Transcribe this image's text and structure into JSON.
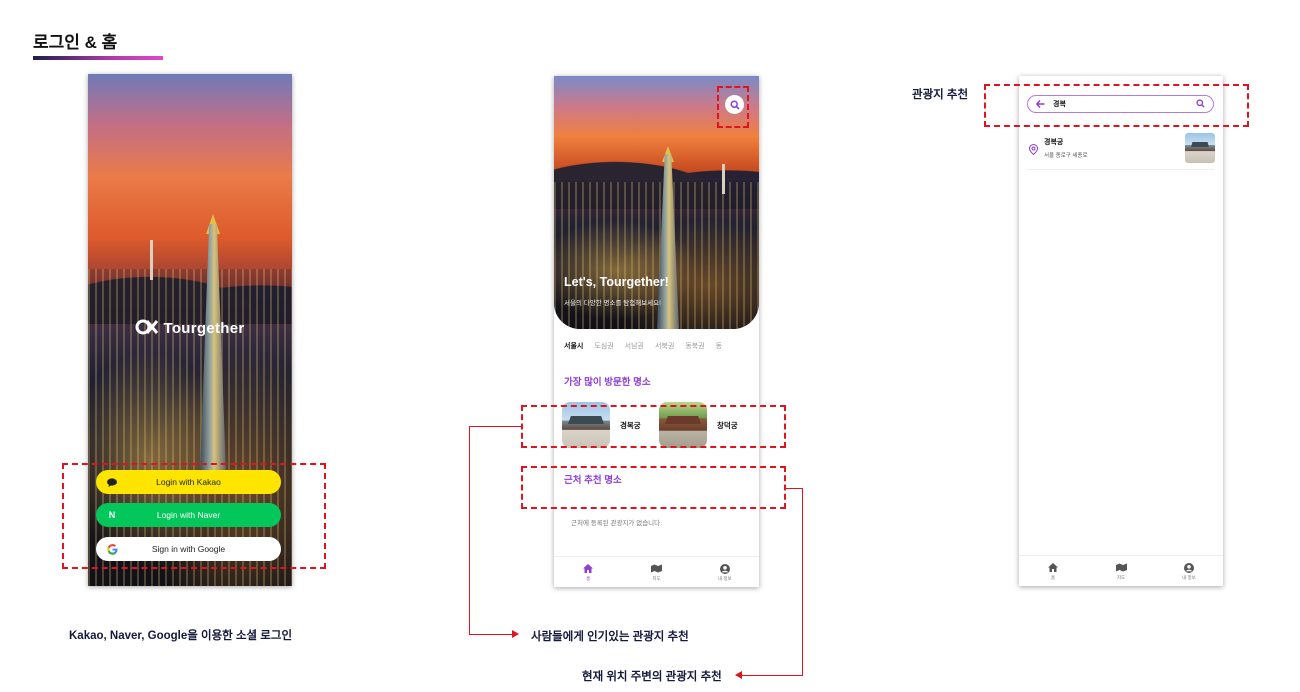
{
  "header": {
    "title": "로그인 & 홈"
  },
  "login": {
    "brand": "Tourgether",
    "buttons": {
      "kakao": "Login with Kakao",
      "naver": "Login with Naver",
      "google": "Sign in with Google"
    },
    "caption": "Kakao, Naver, Google을 이용한 소셜 로그인"
  },
  "home": {
    "hero_title": "Let's, Tourgether!",
    "hero_subtitle": "서울의 다양한 명소를 탐험해보세요!",
    "regions": [
      "서울시",
      "도심권",
      "서남권",
      "서북권",
      "동북권",
      "동"
    ],
    "popular_title": "가장 많이 방문한 명소",
    "popular_spots": [
      {
        "name": "경복궁"
      },
      {
        "name": "창덕궁"
      }
    ],
    "nearby_title": "근처 추천 명소",
    "nearby_empty": "근처에 등록된 관광지가 없습니다.",
    "nav": {
      "home": "홈",
      "map": "지도",
      "mypage": "내 정보"
    }
  },
  "search": {
    "label": "관광지 추천",
    "query": "경복",
    "result": {
      "name": "경복궁",
      "address": "서울 종로구 세종로"
    },
    "nav": {
      "home": "홈",
      "map": "지도",
      "mypage": "내 정보"
    }
  },
  "annotations": {
    "popular": "사람들에게 인기있는 관광지 추천",
    "nearby": "현재 위치 주변의 관광지 추천"
  },
  "colors": {
    "accent": "#8d3fd6",
    "annotation_red": "#e0141e",
    "kakao": "#fee500",
    "naver": "#03c75a"
  }
}
